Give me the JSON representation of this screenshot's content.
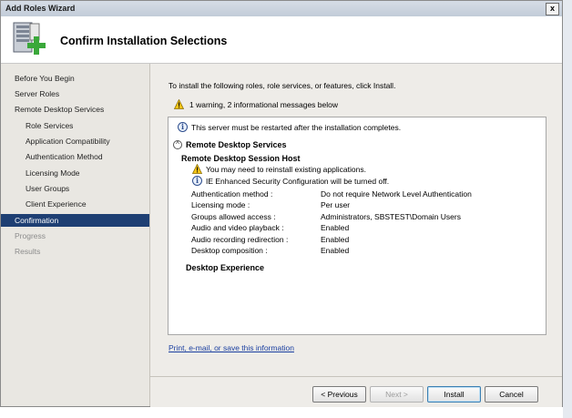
{
  "window": {
    "title": "Add Roles Wizard",
    "close_label": "x"
  },
  "header": {
    "title": "Confirm Installation Selections"
  },
  "nav": {
    "items": [
      {
        "label": "Before You Begin",
        "level": 0,
        "state": "normal"
      },
      {
        "label": "Server Roles",
        "level": 0,
        "state": "normal"
      },
      {
        "label": "Remote Desktop Services",
        "level": 0,
        "state": "normal"
      },
      {
        "label": "Role Services",
        "level": 1,
        "state": "normal"
      },
      {
        "label": "Application Compatibility",
        "level": 1,
        "state": "normal"
      },
      {
        "label": "Authentication Method",
        "level": 1,
        "state": "normal"
      },
      {
        "label": "Licensing Mode",
        "level": 1,
        "state": "normal"
      },
      {
        "label": "User Groups",
        "level": 1,
        "state": "normal"
      },
      {
        "label": "Client Experience",
        "level": 1,
        "state": "normal"
      },
      {
        "label": "Confirmation",
        "level": 0,
        "state": "active"
      },
      {
        "label": "Progress",
        "level": 0,
        "state": "disabled"
      },
      {
        "label": "Results",
        "level": 0,
        "state": "disabled"
      }
    ]
  },
  "content": {
    "intro": "To install the following roles, role services, or features, click Install.",
    "summary_warning": "1 warning, 2 informational messages below",
    "restart_info": "This server must be restarted after the installation completes.",
    "section_title": "Remote Desktop Services",
    "subsection_title": "Remote Desktop Session Host",
    "warning_reinstall": "You may need to reinstall existing applications.",
    "info_ie": "IE Enhanced Security Configuration will be turned off.",
    "settings": [
      {
        "label": "Authentication method :",
        "value": "Do not require Network Level Authentication"
      },
      {
        "label": "Licensing mode :",
        "value": "Per user"
      },
      {
        "label": "Groups allowed access :",
        "value": "Administrators, SBSTEST\\Domain Users"
      },
      {
        "label": "Audio and video playback :",
        "value": "Enabled"
      },
      {
        "label": "Audio recording redirection :",
        "value": "Enabled"
      },
      {
        "label": "Desktop composition :",
        "value": "Enabled"
      }
    ],
    "feature_title": "Desktop Experience",
    "link": "Print, e-mail, or save this information"
  },
  "buttons": {
    "previous": "< Previous",
    "next": "Next >",
    "install": "Install",
    "cancel": "Cancel"
  },
  "colors": {
    "nav_active": "#1e3f73",
    "link": "#1a3fa0",
    "panel": "#eeece8"
  },
  "icons": {
    "warning": "warning-icon",
    "info": "info-icon",
    "collapse": "collapse-chevron-icon",
    "wizard": "server-add-icon"
  }
}
